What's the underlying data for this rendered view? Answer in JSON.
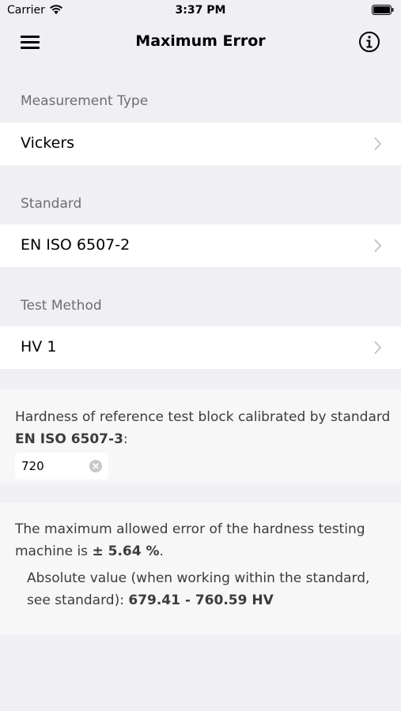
{
  "status_bar": {
    "carrier": "Carrier",
    "time": "3:37 PM"
  },
  "nav": {
    "title": "Maximum Error",
    "menu_icon": "hamburger-menu-icon",
    "info_icon": "info-circle-icon"
  },
  "sections": [
    {
      "header": "Measurement Type",
      "value": "Vickers"
    },
    {
      "header": "Standard",
      "value": "EN ISO 6507-2"
    },
    {
      "header": "Test Method",
      "value": "HV 1"
    }
  ],
  "reference": {
    "text": "Hardness of reference test block calibrated by standard",
    "standard": "EN ISO 6507-3",
    "suffix": ":",
    "value": "720"
  },
  "result": {
    "prefix": "The maximum allowed error of the hardness testing machine is",
    "error": "± 5.64 %",
    "error_suffix": ".",
    "abs_prefix": "Absolute value (when working within the standard, see standard):",
    "abs_range": "679.41 - 760.59 HV"
  },
  "colors": {
    "background": "#efeff4",
    "cell": "#ffffff",
    "panel": "#f7f7f7",
    "secondary_text": "#6d6d72"
  }
}
